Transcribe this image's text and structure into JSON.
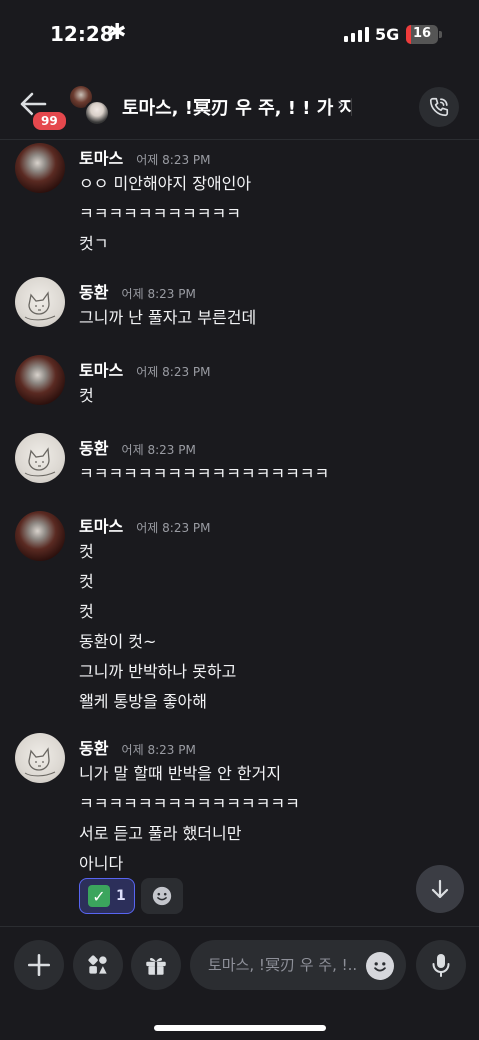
{
  "status_bar": {
    "time": "12:28",
    "network": "5G",
    "battery": "16",
    "battery_level": 0.16
  },
  "header": {
    "back_badge": "99",
    "title": "토마스, !冥刃 우 주, ! ! 가 지",
    "chevron": "›"
  },
  "messages": [
    {
      "author": "토마스",
      "time": "어제 8:23 PM",
      "avatar": "thomas",
      "lines": [
        "ㅇㅇ 미안해야지 장애인아",
        "ㅋㅋㅋㅋㅋㅋㅋㅋㅋㅋㅋ",
        "컷ㄱ"
      ]
    },
    {
      "author": "동환",
      "time": "어제 8:23 PM",
      "avatar": "donghwan",
      "lines": [
        "그니까 난 풀자고 부른건데"
      ]
    },
    {
      "author": "토마스",
      "time": "어제 8:23 PM",
      "avatar": "thomas",
      "lines": [
        "컷"
      ]
    },
    {
      "author": "동환",
      "time": "어제 8:23 PM",
      "avatar": "donghwan",
      "lines": [
        "ㅋㅋㅋㅋㅋㅋㅋㅋㅋㅋㅋㅋㅋㅋㅋㅋㅋ"
      ]
    },
    {
      "author": "토마스",
      "time": "어제 8:23 PM",
      "avatar": "thomas",
      "lines": [
        "컷",
        "컷",
        "컷",
        "동환이 컷~",
        "그니까 반박하나 못하고",
        "왤케 통방을 좋아해"
      ]
    },
    {
      "author": "동환",
      "time": "어제 8:23 PM",
      "avatar": "donghwan",
      "lines": [
        "니가 말 할때 반박을 안 한거지",
        "ㅋㅋㅋㅋㅋㅋㅋㅋㅋㅋㅋㅋㅋㅋㅋ",
        "서로 듣고 풀라 했더니만",
        "아니다"
      ]
    }
  ],
  "reactions": [
    {
      "emoji": "✅",
      "count": "1"
    }
  ],
  "composer": {
    "placeholder": "토마스, !冥刃 우 주, !..."
  },
  "icons": {
    "back": "arrow-left-icon",
    "call": "phone-call-icon",
    "scroll": "arrow-down-icon",
    "plus": "plus-icon",
    "apps": "apps-icon",
    "gift": "gift-icon",
    "emoji": "smiley-icon",
    "mic": "microphone-icon"
  },
  "colors": {
    "background": "#1a1a1e",
    "accent": "#5865f2",
    "badge": "#e5484d"
  }
}
